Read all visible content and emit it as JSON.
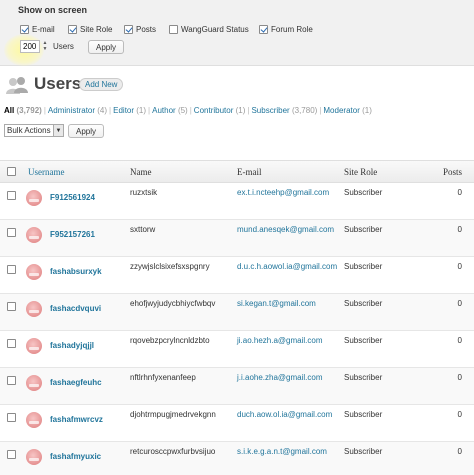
{
  "screen_options": {
    "title": "Show on screen",
    "columns": [
      {
        "label": "E-mail",
        "checked": true
      },
      {
        "label": "Site Role",
        "checked": true
      },
      {
        "label": "Posts",
        "checked": true
      },
      {
        "label": "WangGuard Status",
        "checked": false
      },
      {
        "label": "Forum Role",
        "checked": true
      }
    ],
    "per_page_value": "200",
    "per_page_label": "Users",
    "apply_label": "Apply"
  },
  "header": {
    "title": "Users",
    "add_new_label": "Add New",
    "icon": "users-icon"
  },
  "filters": [
    {
      "label": "All",
      "count": "(3,792)",
      "current": true
    },
    {
      "label": "Administrator",
      "count": "(4)",
      "current": false
    },
    {
      "label": "Editor",
      "count": "(1)",
      "current": false
    },
    {
      "label": "Author",
      "count": "(5)",
      "current": false
    },
    {
      "label": "Contributor",
      "count": "(1)",
      "current": false
    },
    {
      "label": "Subscriber",
      "count": "(3,780)",
      "current": false
    },
    {
      "label": "Moderator",
      "count": "(1)",
      "current": false
    }
  ],
  "bulk": {
    "selected": "Bulk Actions",
    "apply_label": "Apply"
  },
  "table": {
    "headers": {
      "username": "Username",
      "name": "Name",
      "email": "E-mail",
      "role": "Site Role",
      "posts": "Posts"
    },
    "rows": [
      {
        "username": "F912561924",
        "name": "ruzxtsik",
        "email": "ex.t.i.ncteehp@gmail.com",
        "role": "Subscriber",
        "posts": "0"
      },
      {
        "username": "F952157261",
        "name": "sxttorw",
        "email": "mund.anesqek@gmail.com",
        "role": "Subscriber",
        "posts": "0"
      },
      {
        "username": "fashabsurxyk",
        "name": "zzywjslclsixefsxspgnry",
        "email": "d.u.c.h.aowol.ia@gmail.com",
        "role": "Subscriber",
        "posts": "0"
      },
      {
        "username": "fashacdvquvi",
        "name": "ehofjwyjudycbhiycfwbqv",
        "email": "si.kegan.t@gmail.com",
        "role": "Subscriber",
        "posts": "0"
      },
      {
        "username": "fashadyjqjjl",
        "name": "rqovebzpcrylncnldzbto",
        "email": "ji.ao.hezh.a@gmail.com",
        "role": "Subscriber",
        "posts": "0"
      },
      {
        "username": "fashaegfeuhc",
        "name": "nftlrhnfyxenanfeep",
        "email": "j.i.aohe.zha@gmail.com",
        "role": "Subscriber",
        "posts": "0"
      },
      {
        "username": "fashafmwrcvz",
        "name": "djohtrmpugjmedrvekgnn",
        "email": "duch.aow.ol.ia@gmail.com",
        "role": "Subscriber",
        "posts": "0"
      },
      {
        "username": "fashafmyuxic",
        "name": "retcurosccpwxfurbvsijuo",
        "email": "s.i.k.e.g.a.n.t@gmail.com",
        "role": "Subscriber",
        "posts": "0"
      }
    ]
  }
}
